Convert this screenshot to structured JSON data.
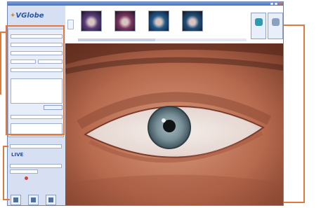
{
  "app": {
    "logo_text": "VGlobe"
  },
  "thumbnails": [
    {
      "label": "",
      "color": "#5a3c7a"
    },
    {
      "label": "",
      "color": "#7a3560"
    },
    {
      "label": "",
      "color": "#1e5a8a"
    },
    {
      "label": "",
      "color": "#1f4f78"
    }
  ],
  "toolbar": {
    "capture_label": "",
    "save_label": ""
  },
  "sidebar": {
    "live_label": "LIVE"
  },
  "colors": {
    "callout": "#e07a3c",
    "title_bar": "#3f6fc4",
    "sidebar_bg": "#d6e0f2",
    "live_text": "#2b4f95"
  }
}
